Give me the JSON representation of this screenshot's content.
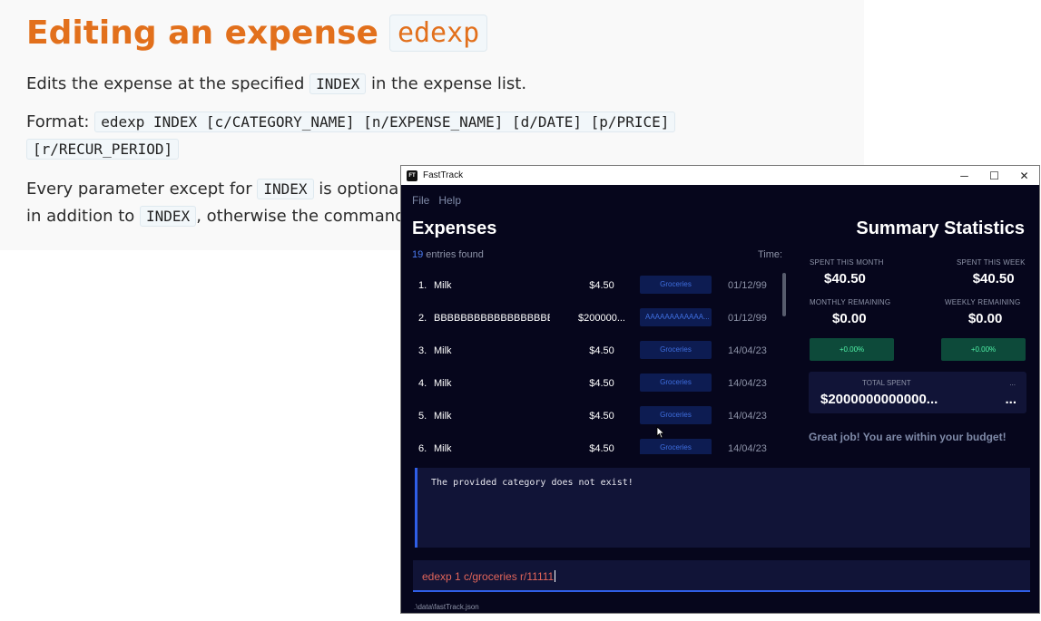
{
  "doc": {
    "title": "Editing an expense",
    "title_code": "edexp",
    "p1": {
      "before": "Edits the expense at the specified ",
      "code": "INDEX",
      "after": " in the expense list."
    },
    "p2": {
      "label": "Format: ",
      "code1": "edexp INDEX [c/CATEGORY_NAME] [n/EXPENSE_NAME] [d/DATE] [p/PRICE]",
      "code2": "[r/RECUR_PERIOD]"
    },
    "p3": {
      "before": "Every parameter except for ",
      "code1": "INDEX",
      "mid": " is optional by",
      "line2_before": "in addition to ",
      "code2": "INDEX",
      "line2_after": ", otherwise the command w"
    }
  },
  "window": {
    "title": "FastTrack",
    "icon_text": "FT",
    "controls": {
      "minimize": "─",
      "maximize": "☐",
      "close": "✕"
    }
  },
  "menu": [
    "File",
    "Help"
  ],
  "expenses": {
    "title": "Expenses",
    "count": "19",
    "count_suffix": " entries found",
    "time_label": "Time:",
    "rows": [
      {
        "index": "1.",
        "name": "Milk",
        "price": "$4.50",
        "category": "Groceries",
        "date": "01/12/99"
      },
      {
        "index": "2.",
        "name": "BBBBBBBBBBBBBBBBBB...",
        "price": "$200000...",
        "category": "AAAAAAAAAAAA...",
        "date": "01/12/99"
      },
      {
        "index": "3.",
        "name": "Milk",
        "price": "$4.50",
        "category": "Groceries",
        "date": "14/04/23"
      },
      {
        "index": "4.",
        "name": "Milk",
        "price": "$4.50",
        "category": "Groceries",
        "date": "14/04/23"
      },
      {
        "index": "5.",
        "name": "Milk",
        "price": "$4.50",
        "category": "Groceries",
        "date": "14/04/23"
      },
      {
        "index": "6.",
        "name": "Milk",
        "price": "$4.50",
        "category": "Groceries",
        "date": "14/04/23"
      }
    ]
  },
  "summary": {
    "title": "Summary Statistics",
    "spent_month": {
      "label": "SPENT THIS MONTH",
      "value": "$40.50"
    },
    "spent_week": {
      "label": "SPENT THIS WEEK",
      "value": "$40.50"
    },
    "monthly_remaining": {
      "label": "MONTHLY REMAINING",
      "value": "$0.00"
    },
    "weekly_remaining": {
      "label": "WEEKLY REMAINING",
      "value": "$0.00"
    },
    "month_change": "+0.00%",
    "week_change": "+0.00%",
    "total": {
      "label": "TOTAL SPENT",
      "value": "$2000000000000...",
      "ellipsis_small": "...",
      "ellipsis_large": "..."
    },
    "budget_message": "Great job! You are within your budget!"
  },
  "result": "The provided category does not exist!",
  "command": "edexp 1 c/groceries r/11111",
  "status_path": ".\\data\\fastTrack.json",
  "colors": {
    "accent": "#2f5ee6",
    "doc_title": "#e2701c",
    "background": "#06061c",
    "panel": "#111437",
    "positive": "#4ff0a6",
    "command_text": "#e1655a"
  }
}
